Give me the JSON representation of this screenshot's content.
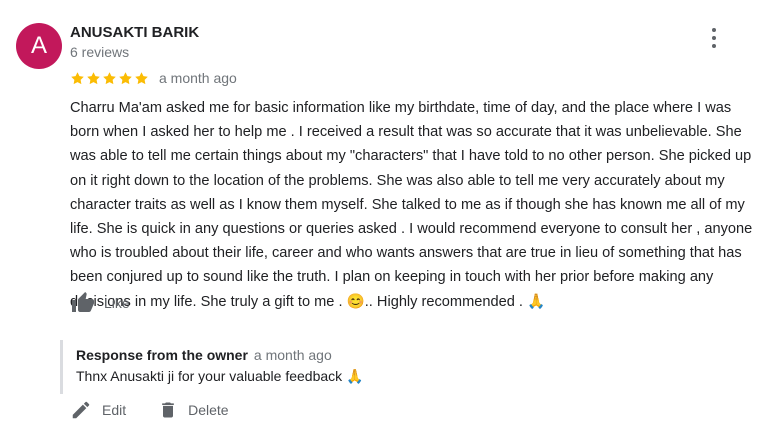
{
  "review": {
    "author_initial": "A",
    "author_name": "ANUSAKTI BARIK",
    "review_count": "6 reviews",
    "rating": 5,
    "age": "a month ago",
    "text": "Charru Ma'am asked me for basic information like my birthdate, time of day, and the place where I was born when I asked her to help me . I received a result that was so accurate that it was unbelievable. She was able to tell me certain things about my \"characters\" that I have told to no other person. She picked up on it right down to the location of the problems. She was also able to tell me very accurately about my character traits as well as I know them myself. She talked to me as if though she has known me all of my life. She is quick in any questions or queries asked . I would recommend everyone to consult her , anyone who is troubled about their life, career and who wants answers that are true in lieu of something that has been conjured up to sound like the truth. I plan on keeping in touch with her prior before making any decisions in my life. She truly a gift to me . 😊.. Highly recommended . 🙏",
    "like_label": "Like"
  },
  "response": {
    "heading": "Response from the owner",
    "age": "a month ago",
    "text": "Thnx Anusakti ji for your valuable feedback 🙏"
  },
  "actions": {
    "edit_label": "Edit",
    "delete_label": "Delete"
  },
  "colors": {
    "avatar": "#c2185b",
    "star": "#fbbc04",
    "secondary_text": "#70757a",
    "icon": "#5f6368"
  }
}
